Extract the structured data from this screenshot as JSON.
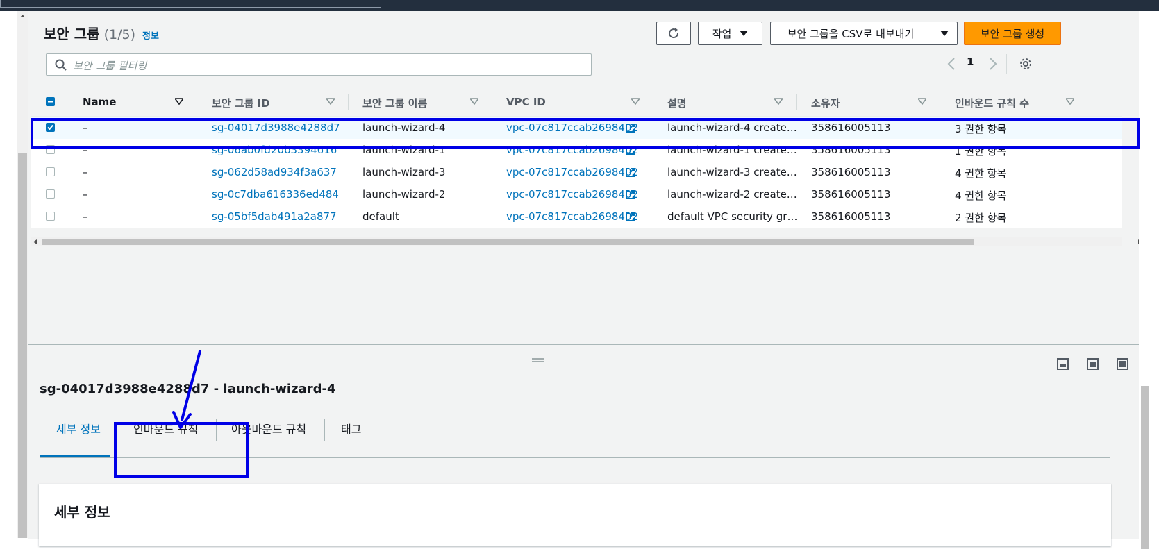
{
  "panel": {
    "title": "보안 그룹",
    "count": "(1/5)",
    "info_link": "정보"
  },
  "toolbar": {
    "actions_label": "작업",
    "export_label": "보안 그룹을 CSV로 내보내기",
    "create_label": "보안 그룹 생성"
  },
  "search": {
    "placeholder": "보안 그룹 필터링"
  },
  "pagination": {
    "current_page": "1"
  },
  "table": {
    "columns": [
      "Name",
      "보안 그룹 ID",
      "보안 그룹 이름",
      "VPC ID",
      "설명",
      "소유자",
      "인바운드 규칙 수"
    ],
    "rows": [
      {
        "name": "–",
        "sg_id": "sg-04017d3988e4288d7",
        "sg_name": "launch-wizard-4",
        "vpc_id": "vpc-07c817ccab2698402",
        "description": "launch-wizard-4 create…",
        "owner": "358616005113",
        "inbound": "3 권한 항목",
        "selected": true
      },
      {
        "name": "–",
        "sg_id": "sg-06ab0fd20b3394616",
        "sg_name": "launch-wizard-1",
        "vpc_id": "vpc-07c817ccab2698402",
        "description": "launch-wizard-1 create…",
        "owner": "358616005113",
        "inbound": "1 권한 항목",
        "selected": false
      },
      {
        "name": "–",
        "sg_id": "sg-062d58ad934f3a637",
        "sg_name": "launch-wizard-3",
        "vpc_id": "vpc-07c817ccab2698402",
        "description": "launch-wizard-3 create…",
        "owner": "358616005113",
        "inbound": "4 권한 항목",
        "selected": false
      },
      {
        "name": "–",
        "sg_id": "sg-0c7dba616336ed484",
        "sg_name": "launch-wizard-2",
        "vpc_id": "vpc-07c817ccab2698402",
        "description": "launch-wizard-2 create…",
        "owner": "358616005113",
        "inbound": "4 권한 항목",
        "selected": false
      },
      {
        "name": "–",
        "sg_id": "sg-05bf5dab491a2a877",
        "sg_name": "default",
        "vpc_id": "vpc-07c817ccab2698402",
        "description": "default VPC security gr…",
        "owner": "358616005113",
        "inbound": "2 권한 항목",
        "selected": false
      }
    ]
  },
  "detail": {
    "title": "sg-04017d3988e4288d7 - launch-wizard-4",
    "tabs": [
      {
        "label": "세부 정보",
        "active": true
      },
      {
        "label": "인바운드 규칙",
        "active": false
      },
      {
        "label": "아웃바운드 규칙",
        "active": false
      },
      {
        "label": "태그",
        "active": false
      }
    ],
    "section_title": "세부 정보"
  },
  "colors": {
    "link": "#0073bb",
    "primary_button": "#ff9900",
    "annotation": "#0000e6",
    "topbar": "#232f3e"
  },
  "icons": [
    "refresh-icon",
    "caret-down-icon",
    "search-icon",
    "chevron-left-icon",
    "chevron-right-icon",
    "gear-icon",
    "sort-icon",
    "external-link-icon",
    "drag-handle-icon",
    "panel-bottom-icon",
    "panel-side-icon",
    "panel-full-icon"
  ]
}
